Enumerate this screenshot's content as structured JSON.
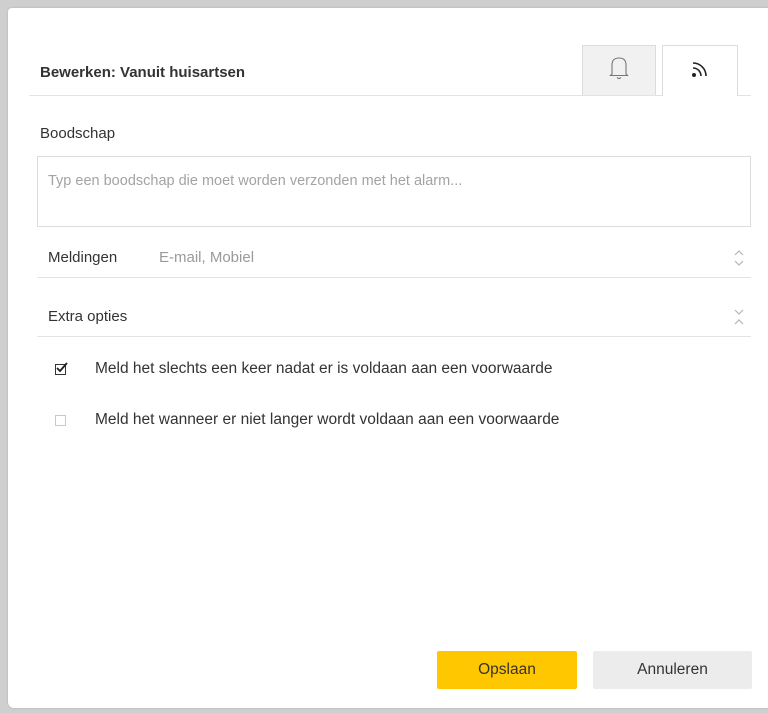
{
  "dialog": {
    "title": "Bewerken: Vanuit huisartsen",
    "tabs": [
      {
        "icon": "bell-icon",
        "active": false
      },
      {
        "icon": "rss-icon",
        "active": true
      }
    ]
  },
  "message": {
    "label": "Boodschap",
    "placeholder": "Typ een boodschap die moet worden verzonden met het alarm..."
  },
  "notifications": {
    "label": "Meldingen",
    "value": "E-mail, Mobiel"
  },
  "extra": {
    "label": "Extra opties",
    "options": [
      {
        "label": "Meld het slechts een keer nadat er is voldaan aan een voorwaarde",
        "checked": true
      },
      {
        "label": "Meld het wanneer er niet langer wordt voldaan aan een voorwaarde",
        "checked": false
      }
    ]
  },
  "buttons": {
    "save": "Opslaan",
    "cancel": "Annuleren"
  },
  "colors": {
    "primary": "#ffc700",
    "secondary": "#ececec"
  }
}
